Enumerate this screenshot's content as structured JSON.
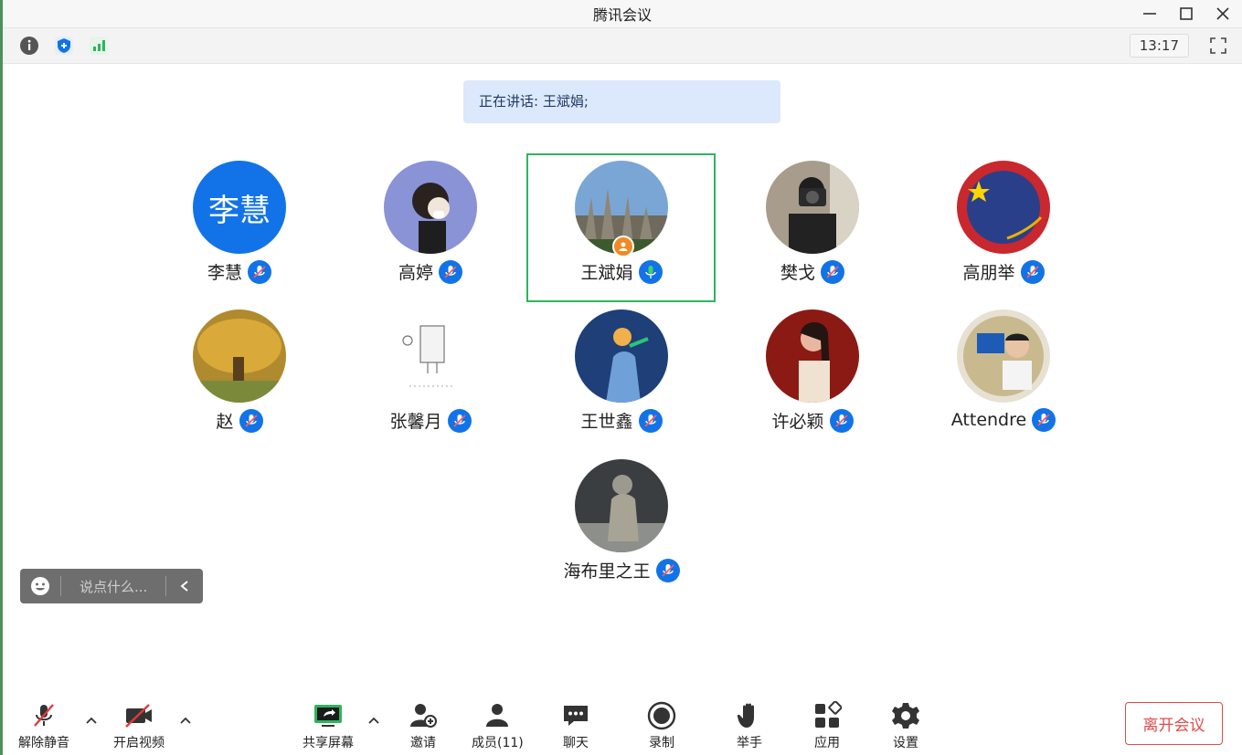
{
  "window": {
    "title": "腾讯会议"
  },
  "toolbar": {
    "icons": [
      "info-icon",
      "shield-icon",
      "signal-icon"
    ],
    "clock": "13:17"
  },
  "speaking_banner": "正在讲话: 王斌娟;",
  "participants": [
    {
      "name": "李慧",
      "avatar_text": "李慧",
      "avatar_kind": "text",
      "mic": "muted"
    },
    {
      "name": "高婷",
      "avatar_kind": "photo",
      "mic": "muted"
    },
    {
      "name": "王斌娟",
      "avatar_kind": "photo",
      "mic": "speaking",
      "host": true
    },
    {
      "name": "樊戈",
      "avatar_kind": "photo",
      "mic": "muted"
    },
    {
      "name": "高朋举",
      "avatar_kind": "photo",
      "mic": "muted"
    },
    {
      "name": "赵",
      "avatar_kind": "photo",
      "mic": "muted"
    },
    {
      "name": "张馨月",
      "avatar_kind": "photo",
      "mic": "muted"
    },
    {
      "name": "王世鑫",
      "avatar_kind": "photo",
      "mic": "muted"
    },
    {
      "name": "许必颖",
      "avatar_kind": "photo",
      "mic": "muted"
    },
    {
      "name": "Attendre",
      "avatar_kind": "photo",
      "mic": "muted"
    },
    {
      "name": "海布里之王",
      "avatar_kind": "photo",
      "mic": "muted"
    }
  ],
  "chat": {
    "placeholder": "说点什么..."
  },
  "bottom_toolbar": {
    "unmute": "解除静音",
    "video": "开启视频",
    "share": "共享屏幕",
    "invite": "邀请",
    "members": "成员(11)",
    "chat": "聊天",
    "record": "录制",
    "raise_hand": "举手",
    "apps": "应用",
    "settings": "设置",
    "leave": "离开会议"
  },
  "colors": {
    "accent": "#1273e8",
    "speaking_frame": "#2db55d",
    "leave": "#e04a4a",
    "banner_bg": "#dce8fb"
  }
}
